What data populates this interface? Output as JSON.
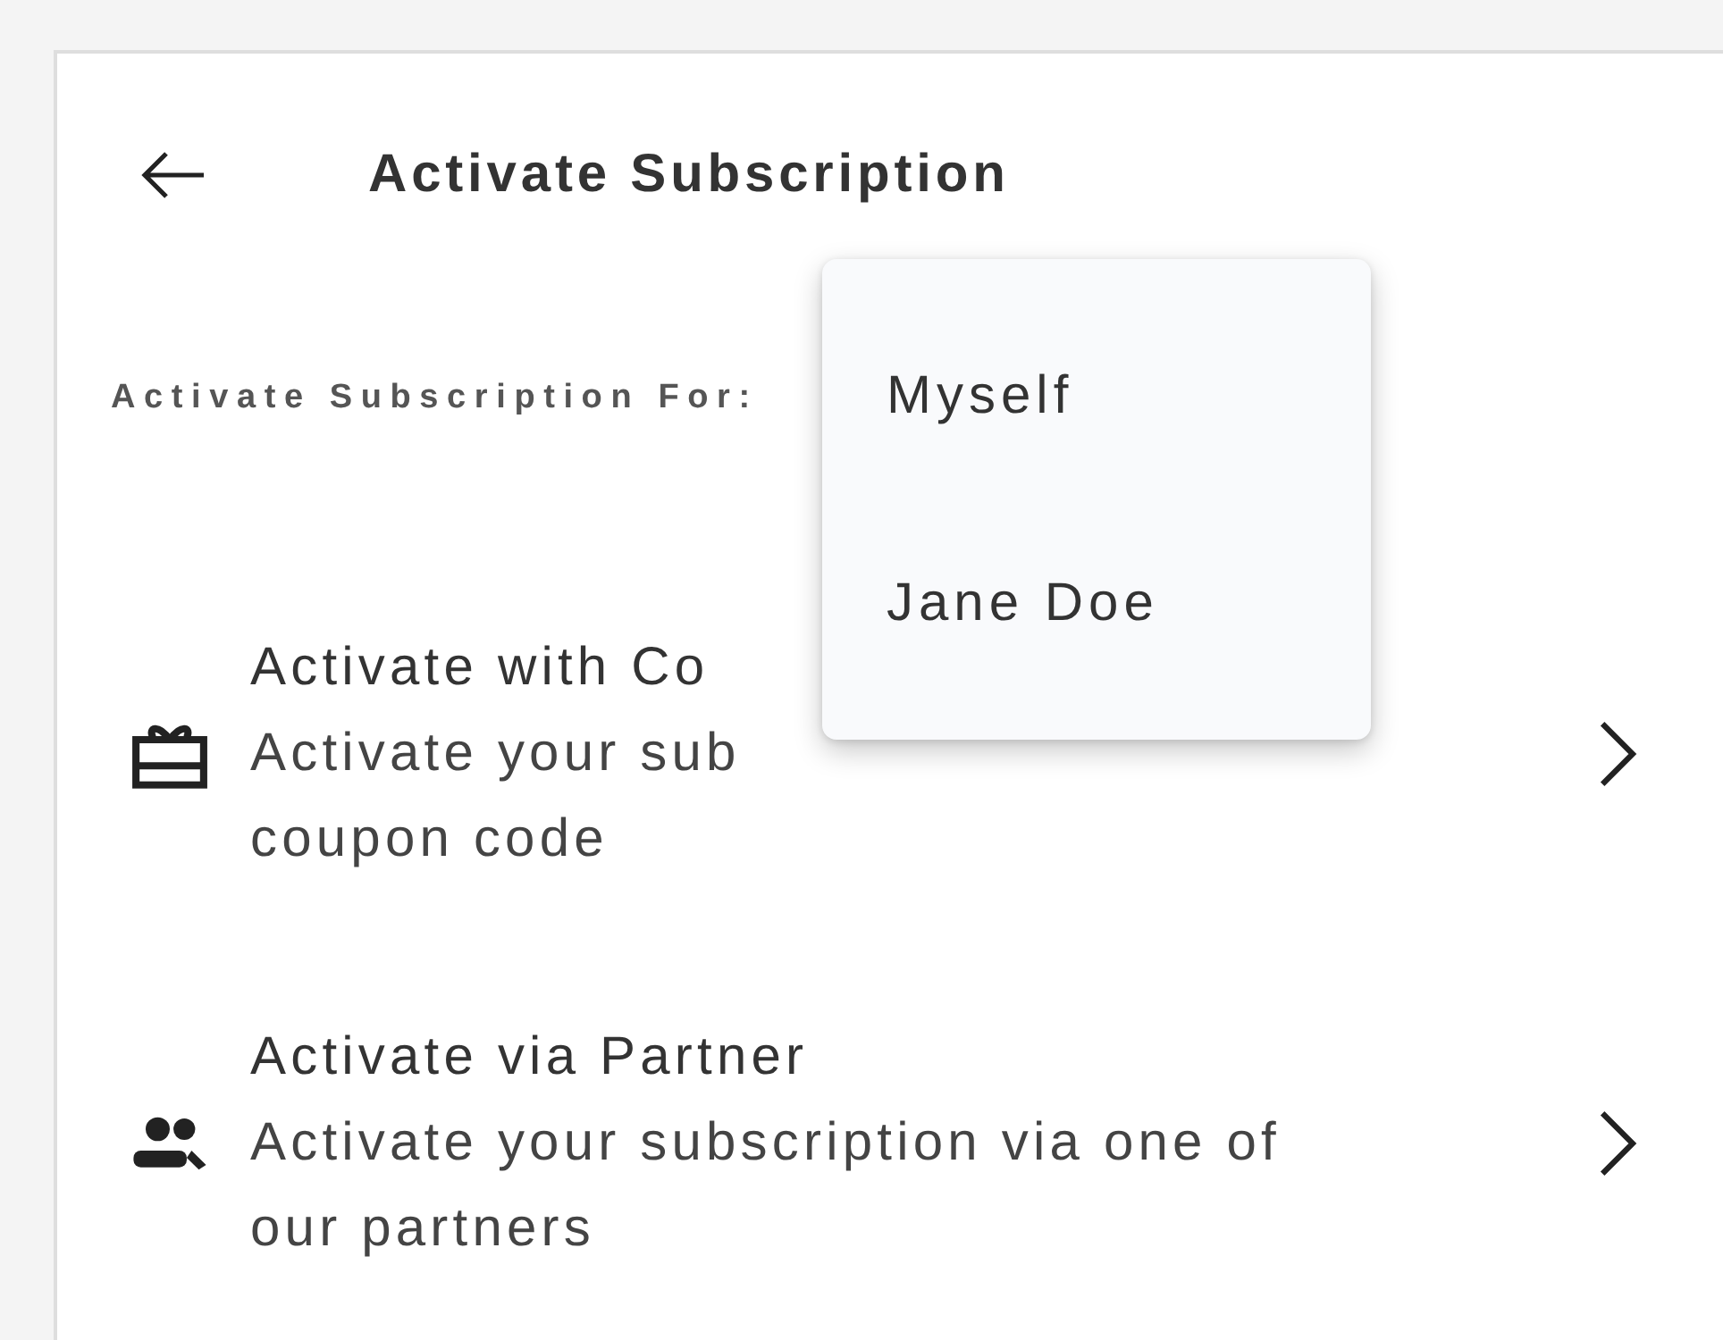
{
  "header": {
    "title": "Activate Subscription"
  },
  "for_label": "Activate Subscription For:",
  "options": [
    {
      "kind": "coupon",
      "title": "Activate with Co",
      "subtitle_lines": [
        "Activate your sub",
        "coupon code"
      ]
    },
    {
      "kind": "partner",
      "title": "Activate via Partner",
      "subtitle_lines": [
        "Activate your subscription via one of",
        "our partners"
      ]
    }
  ],
  "menu": {
    "items": [
      {
        "label": "Myself",
        "selected": false
      },
      {
        "label": "Jane Doe",
        "selected": false
      }
    ]
  }
}
